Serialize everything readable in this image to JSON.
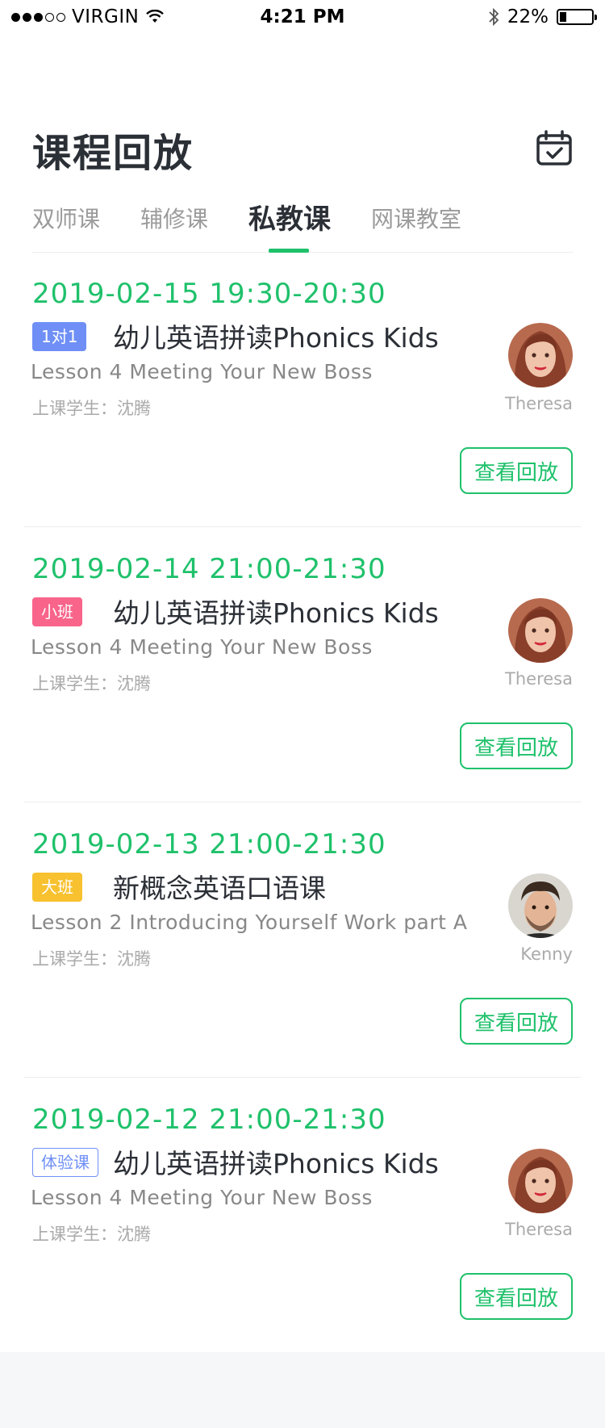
{
  "status_bar": {
    "signal_dots": [
      1,
      1,
      1,
      0,
      0
    ],
    "carrier": "VIRGIN",
    "time": "4:21 PM",
    "battery": "22%",
    "battery_level": 0.22
  },
  "header": {
    "title": "课程回放",
    "calendar_icon": "calendar-check-icon"
  },
  "tabs": [
    {
      "label": "双师课",
      "active": false
    },
    {
      "label": "辅修课",
      "active": false
    },
    {
      "label": "私教课",
      "active": true
    },
    {
      "label": "网课教室",
      "active": false
    }
  ],
  "courses": [
    {
      "datetime": "2019-02-15  19:30-20:30",
      "tag": "1对1",
      "tag_style": {
        "bg": "#6f8ff6",
        "fg": "#ffffff",
        "border": "#6f8ff6"
      },
      "title": "幼儿英语拼读Phonics Kids",
      "lesson": "Lesson 4  Meeting Your New Boss",
      "student": "上课学生：沈腾",
      "teacher": "Theresa",
      "avatar": "female",
      "replay_label": "查看回放"
    },
    {
      "datetime": "2019-02-14  21:00-21:30",
      "tag": "小班",
      "tag_style": {
        "bg": "#f8648a",
        "fg": "#ffffff",
        "border": "#f8648a"
      },
      "title": "幼儿英语拼读Phonics Kids",
      "lesson": "Lesson 4  Meeting Your New Boss",
      "student": "上课学生：沈腾",
      "teacher": "Theresa",
      "avatar": "female",
      "replay_label": "查看回放"
    },
    {
      "datetime": "2019-02-13  21:00-21:30",
      "tag": "大班",
      "tag_style": {
        "bg": "#f7c12f",
        "fg": "#ffffff",
        "border": "#f7c12f"
      },
      "title": "新概念英语口语课",
      "lesson": "Lesson 2  Introducing Yourself Work part A",
      "student": "上课学生：沈腾",
      "teacher": "Kenny",
      "avatar": "male",
      "replay_label": "查看回放"
    },
    {
      "datetime": "2019-02-12  21:00-21:30",
      "tag": "体验课",
      "tag_style": {
        "bg": "#ffffff",
        "fg": "#6f8ff6",
        "border": "#6f8ff6"
      },
      "title": "幼儿英语拼读Phonics Kids",
      "lesson": "Lesson 4  Meeting Your New Boss",
      "student": "上课学生：沈腾",
      "teacher": "Theresa",
      "avatar": "female",
      "replay_label": "查看回放"
    }
  ],
  "colors": {
    "accent_green": "#1fc16b",
    "title_text": "#2b2f36",
    "muted_text": "#9b9b9b"
  }
}
